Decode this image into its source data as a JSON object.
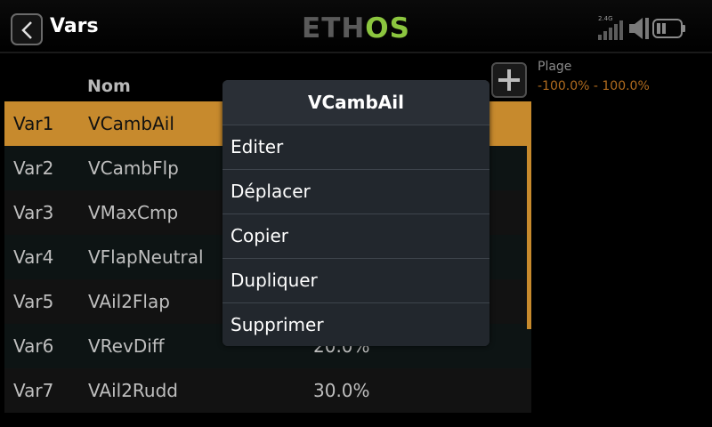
{
  "header": {
    "title": "Vars",
    "logo_text": "ETHOS",
    "signal_band": "2.4G"
  },
  "table": {
    "columns": [
      "Nom"
    ],
    "rows": [
      {
        "id": "Var1",
        "name": "VCambAil",
        "value": ""
      },
      {
        "id": "Var2",
        "name": "VCambFlp",
        "value": ""
      },
      {
        "id": "Var3",
        "name": "VMaxCmp",
        "value": ""
      },
      {
        "id": "Var4",
        "name": "VFlapNeutral",
        "value": ""
      },
      {
        "id": "Var5",
        "name": "VAil2Flap",
        "value": ""
      },
      {
        "id": "Var6",
        "name": "VRevDiff",
        "value": "20.0%"
      },
      {
        "id": "Var7",
        "name": "VAil2Rudd",
        "value": "30.0%"
      }
    ],
    "selected_index": 0
  },
  "range": {
    "label": "Plage",
    "value": "-100.0% - 100.0%"
  },
  "popup": {
    "title": "VCambAil",
    "items": [
      "Editer",
      "Déplacer",
      "Copier",
      "Dupliquer",
      "Supprimer"
    ]
  },
  "colors": {
    "accent": "#c78a2d",
    "logo_green": "#8cc63f",
    "range_value": "#b06b1e"
  }
}
